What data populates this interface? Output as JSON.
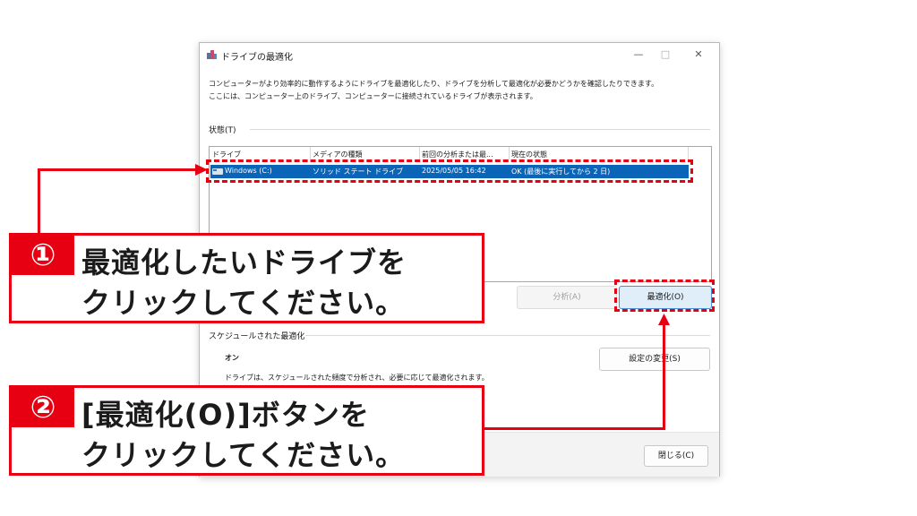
{
  "window": {
    "title": "ドライブの最適化",
    "minimize_glyph": "—",
    "maximize_glyph": "□",
    "close_glyph": "✕"
  },
  "description": {
    "line1": "コンピューターがより効率的に動作するようにドライブを最適化したり、ドライブを分析して最適化が必要かどうかを確認したりできます。",
    "line2": "ここには、コンピューター上のドライブ、コンピューターに接続されているドライブが表示されます。"
  },
  "status": {
    "label": "状態(T)",
    "columns": [
      "ドライブ",
      "メディアの種類",
      "前回の分析または最...",
      "現在の状態"
    ],
    "rows": [
      {
        "drive": "Windows (C:)",
        "media": "ソリッド ステート ドライブ",
        "last": "2025/05/05 16:42",
        "state": "OK (最後に実行してから 2 日)"
      }
    ]
  },
  "buttons": {
    "analyze": "分析(A)",
    "optimize": "最適化(O)",
    "settings": "設定の変更(S)",
    "close": "閉じる(C)"
  },
  "schedule": {
    "label": "スケジュールされた最適化",
    "state": "オン",
    "description": "ドライブは、スケジュールされた頻度で分析され、必要に応じて最適化されます。"
  },
  "callouts": [
    {
      "number": "①",
      "line1": "最適化したいドライブを",
      "line2": "クリックしてください。"
    },
    {
      "number": "②",
      "line1": "[最適化(O)]ボタンを",
      "line2": "クリックしてください。"
    }
  ],
  "colors": {
    "accent_red": "#e60012",
    "selection_blue": "#0a64b8"
  }
}
